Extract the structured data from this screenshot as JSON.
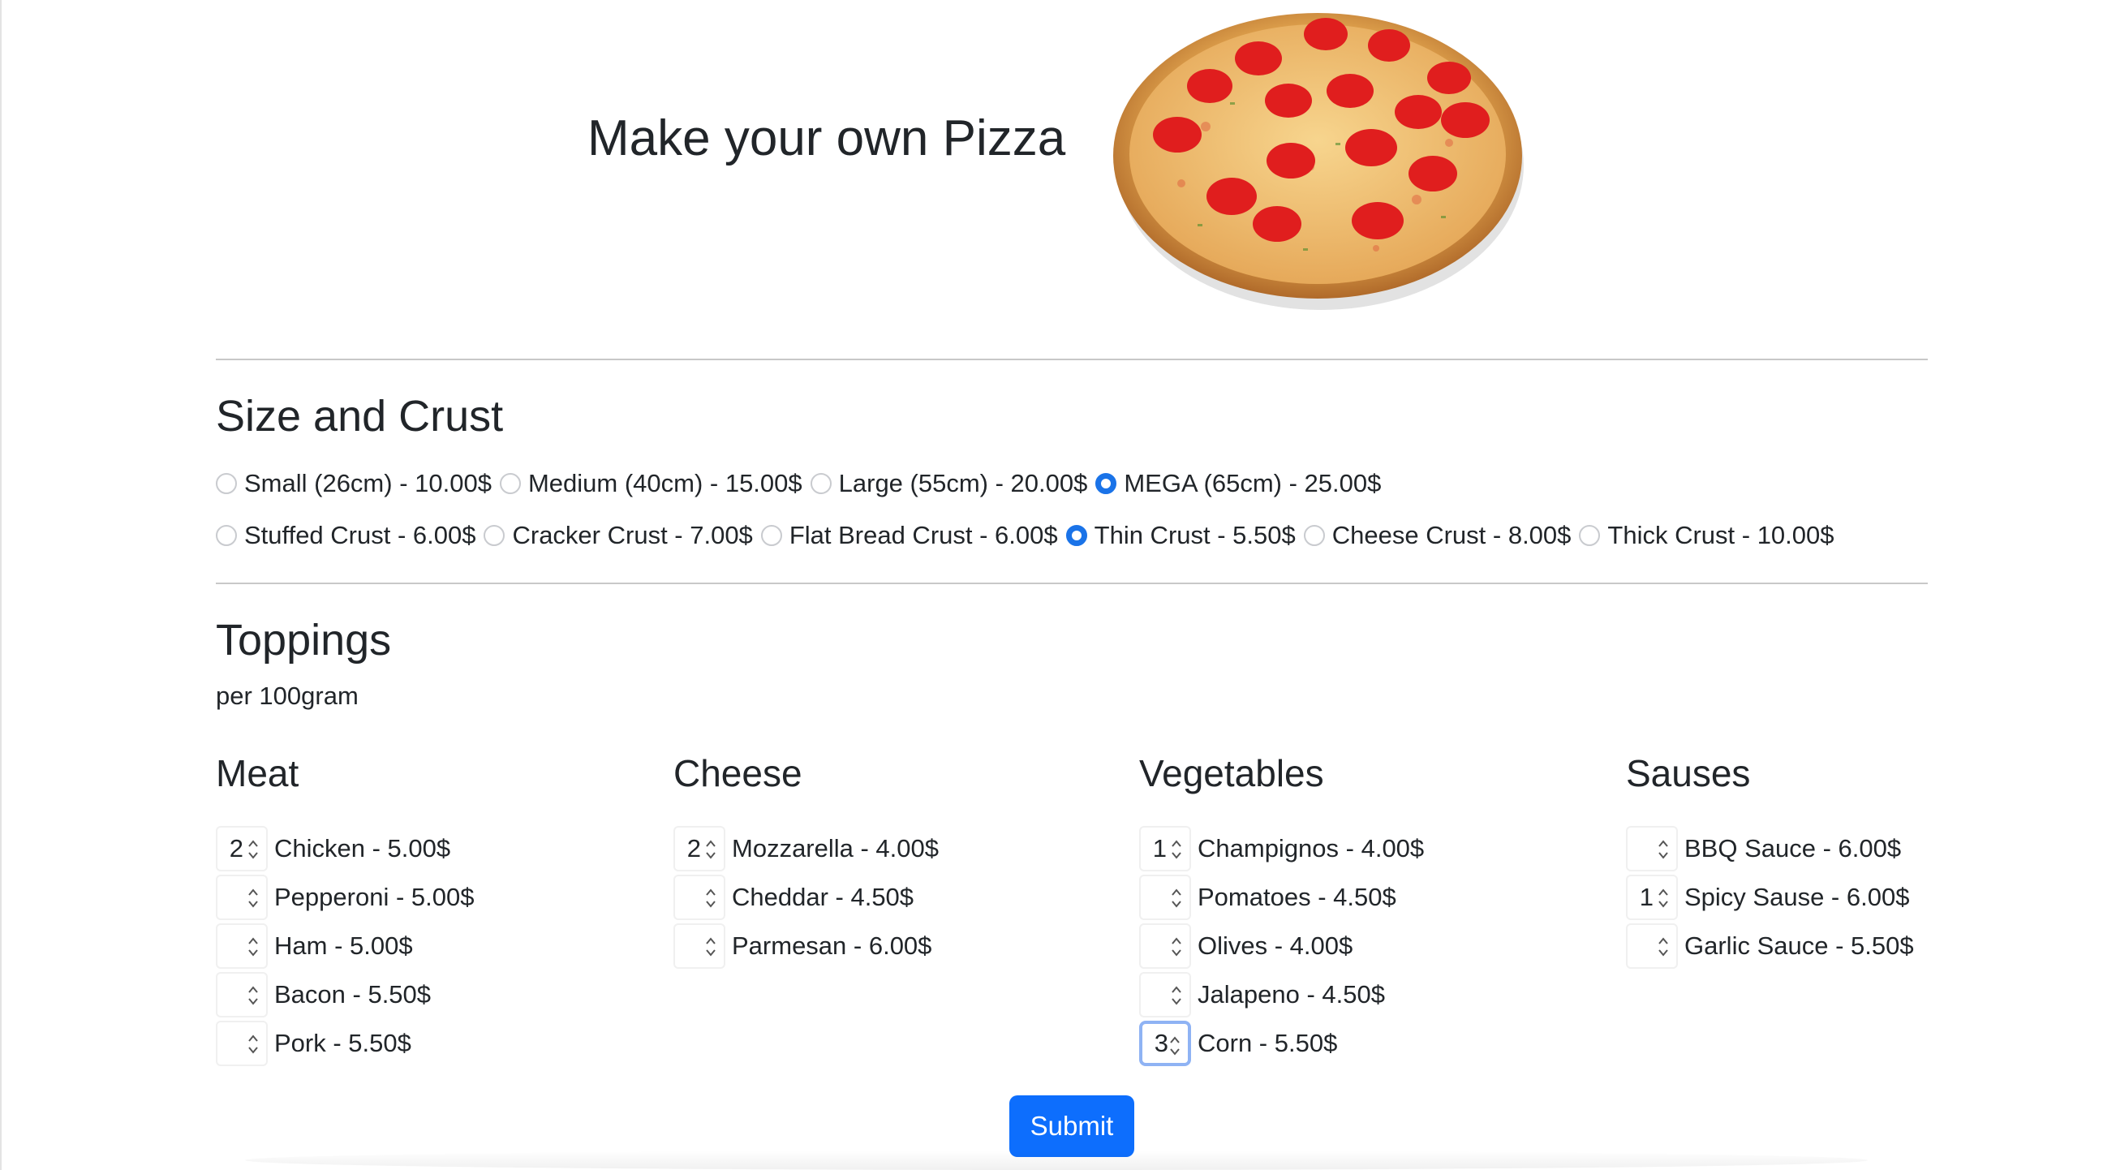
{
  "header": {
    "title": "Make your own Pizza",
    "image_icon": "pizza-image"
  },
  "size_crust": {
    "title": "Size and Crust",
    "sizes": [
      {
        "label": "Small (26cm) - 10.00$",
        "checked": false
      },
      {
        "label": "Medium (40cm) - 15.00$",
        "checked": false
      },
      {
        "label": "Large (55cm) - 20.00$",
        "checked": false
      },
      {
        "label": "MEGA (65cm) - 25.00$",
        "checked": true
      }
    ],
    "crusts": [
      {
        "label": "Stuffed Crust - 6.00$",
        "checked": false
      },
      {
        "label": "Cracker Crust - 7.00$",
        "checked": false
      },
      {
        "label": "Flat Bread Crust - 6.00$",
        "checked": false
      },
      {
        "label": "Thin Crust - 5.50$",
        "checked": true
      },
      {
        "label": "Cheese Crust - 8.00$",
        "checked": false
      },
      {
        "label": "Thick Crust - 10.00$",
        "checked": false
      }
    ]
  },
  "toppings": {
    "title": "Toppings",
    "subtitle": "per 100gram",
    "meat": {
      "title": "Meat",
      "items": [
        {
          "label": "Chicken - 5.00$",
          "qty": "2"
        },
        {
          "label": "Pepperoni - 5.00$",
          "qty": ""
        },
        {
          "label": "Ham - 5.00$",
          "qty": ""
        },
        {
          "label": "Bacon - 5.50$",
          "qty": ""
        },
        {
          "label": "Pork - 5.50$",
          "qty": ""
        }
      ]
    },
    "cheese": {
      "title": "Cheese",
      "items": [
        {
          "label": "Mozzarella - 4.00$",
          "qty": "2"
        },
        {
          "label": "Cheddar - 4.50$",
          "qty": ""
        },
        {
          "label": "Parmesan - 6.00$",
          "qty": ""
        }
      ]
    },
    "vegetables": {
      "title": "Vegetables",
      "items": [
        {
          "label": "Champignos - 4.00$",
          "qty": "1"
        },
        {
          "label": "Pomatoes - 4.50$",
          "qty": ""
        },
        {
          "label": "Olives - 4.00$",
          "qty": ""
        },
        {
          "label": "Jalapeno - 4.50$",
          "qty": ""
        },
        {
          "label": "Corn - 5.50$",
          "qty": "3"
        }
      ]
    },
    "sauses": {
      "title": "Sauses",
      "items": [
        {
          "label": "BBQ Sauce - 6.00$",
          "qty": ""
        },
        {
          "label": "Spicy Sause - 6.00$",
          "qty": "1"
        },
        {
          "label": "Garlic Sauce - 5.50$",
          "qty": ""
        }
      ]
    }
  },
  "submit_label": "Submit",
  "colors": {
    "accent": "#0d6efd",
    "radio_checked": "#1a73e8",
    "text": "#212529",
    "divider": "#c8c8c8",
    "focus_ring": "#8fb3f4"
  }
}
